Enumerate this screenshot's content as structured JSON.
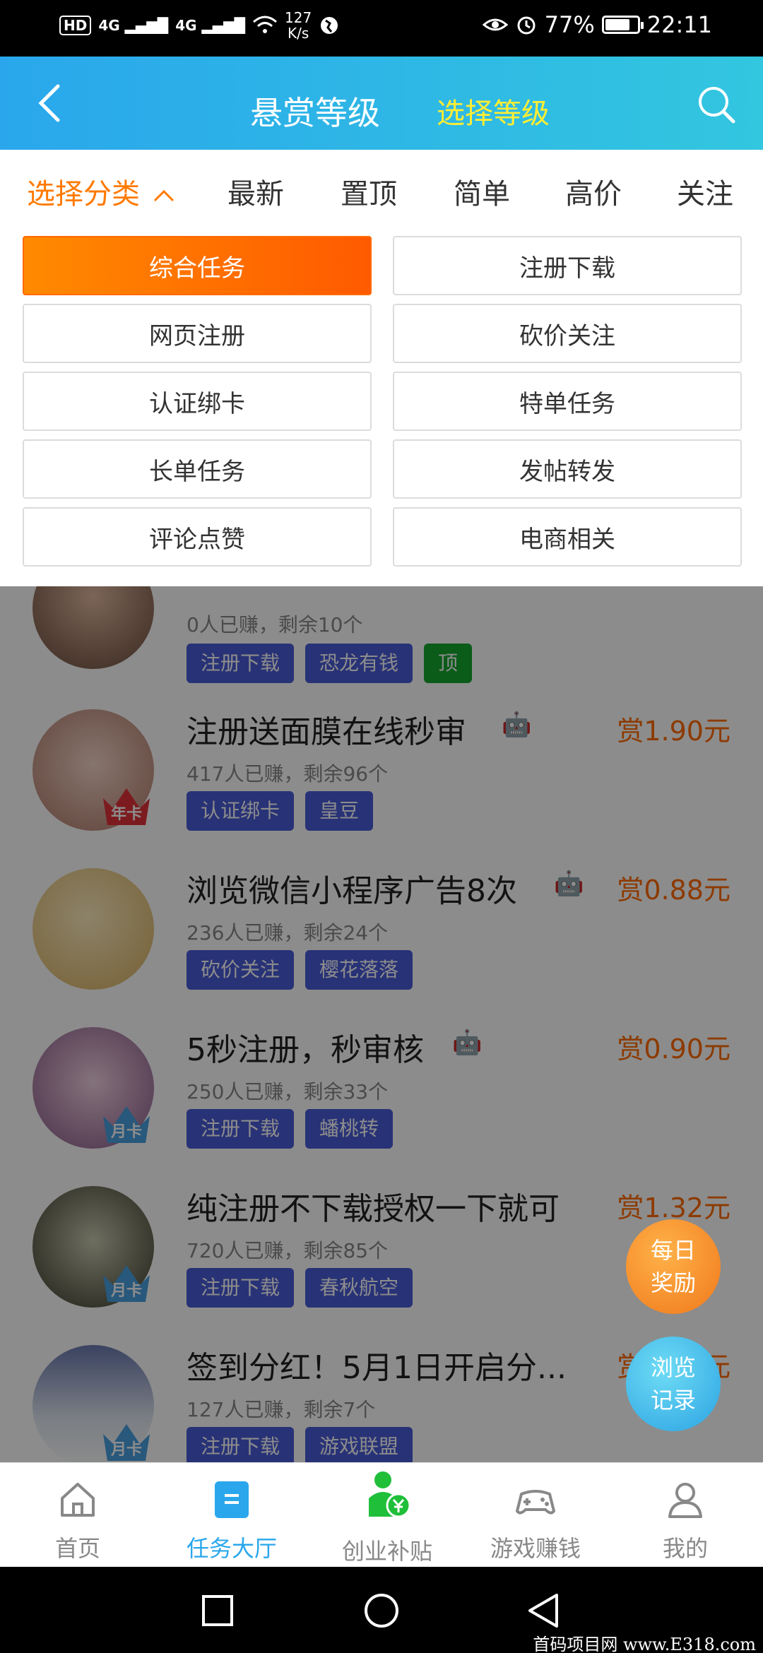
{
  "status_bar": {
    "hd": "HD",
    "network1": "4G",
    "network2": "4G",
    "speed_value": "127",
    "speed_unit": "K/s",
    "battery": "77%",
    "battery_level": 0.77,
    "time": "22:11"
  },
  "header": {
    "title": "悬赏等级",
    "level_link": "选择等级"
  },
  "filter_tabs": [
    {
      "label": "选择分类"
    },
    {
      "label": "最新"
    },
    {
      "label": "置顶"
    },
    {
      "label": "简单"
    },
    {
      "label": "高价"
    },
    {
      "label": "关注"
    }
  ],
  "categories": [
    "综合任务",
    "注册下载",
    "网页注册",
    "砍价关注",
    "认证绑卡",
    "特单任务",
    "长单任务",
    "发帖转发",
    "评论点赞",
    "电商相关"
  ],
  "tasks": [
    {
      "title": "",
      "stats": "0人已赚，剩余10个",
      "tags": [
        "注册下载",
        "恐龙有钱",
        "顶"
      ],
      "reward": "",
      "badge": ""
    },
    {
      "title": "注册送面膜在线秒审",
      "stats": "417人已赚，剩余96个",
      "tags": [
        "认证绑卡",
        "皇豆"
      ],
      "reward": "赏1.90元",
      "badge": "年卡"
    },
    {
      "title": "浏览微信小程序广告8次",
      "stats": "236人已赚，剩余24个",
      "tags": [
        "砍价关注",
        "樱花落落"
      ],
      "reward": "赏0.88元",
      "badge": ""
    },
    {
      "title": "5秒注册，秒审核",
      "stats": "250人已赚，剩余33个",
      "tags": [
        "注册下载",
        "蟠桃转"
      ],
      "reward": "赏0.90元",
      "badge": "月卡"
    },
    {
      "title": "纯注册不下载授权一下就可",
      "stats": "720人已赚，剩余85个",
      "tags": [
        "注册下载",
        "春秋航空"
      ],
      "reward": "赏1.32元",
      "badge": "月卡"
    },
    {
      "title": "签到分红！5月1日开启分...",
      "stats": "127人已赚，剩余7个",
      "tags": [
        "注册下载",
        "游戏联盟"
      ],
      "reward": "赏1.00元",
      "badge": "月卡"
    }
  ],
  "floating": {
    "daily_line1": "每日",
    "daily_line2": "奖励",
    "history_line1": "浏览",
    "history_line2": "记录"
  },
  "bottom_nav": [
    {
      "label": "首页",
      "icon": "home-icon"
    },
    {
      "label": "任务大厅",
      "icon": "task-hall-icon"
    },
    {
      "label": "创业补贴",
      "icon": "subsidy-icon"
    },
    {
      "label": "游戏赚钱",
      "icon": "gamepad-icon"
    },
    {
      "label": "我的",
      "icon": "profile-icon"
    }
  ],
  "watermark": "首码项目网 www.E318.com",
  "colors": {
    "header_start": "#2aa7ec",
    "header_end": "#32c6df",
    "accent_orange": "#ff7a00",
    "tag_blue": "#4a5bd8",
    "tag_green": "#15a62e",
    "nav_active": "#2aa7ec"
  }
}
